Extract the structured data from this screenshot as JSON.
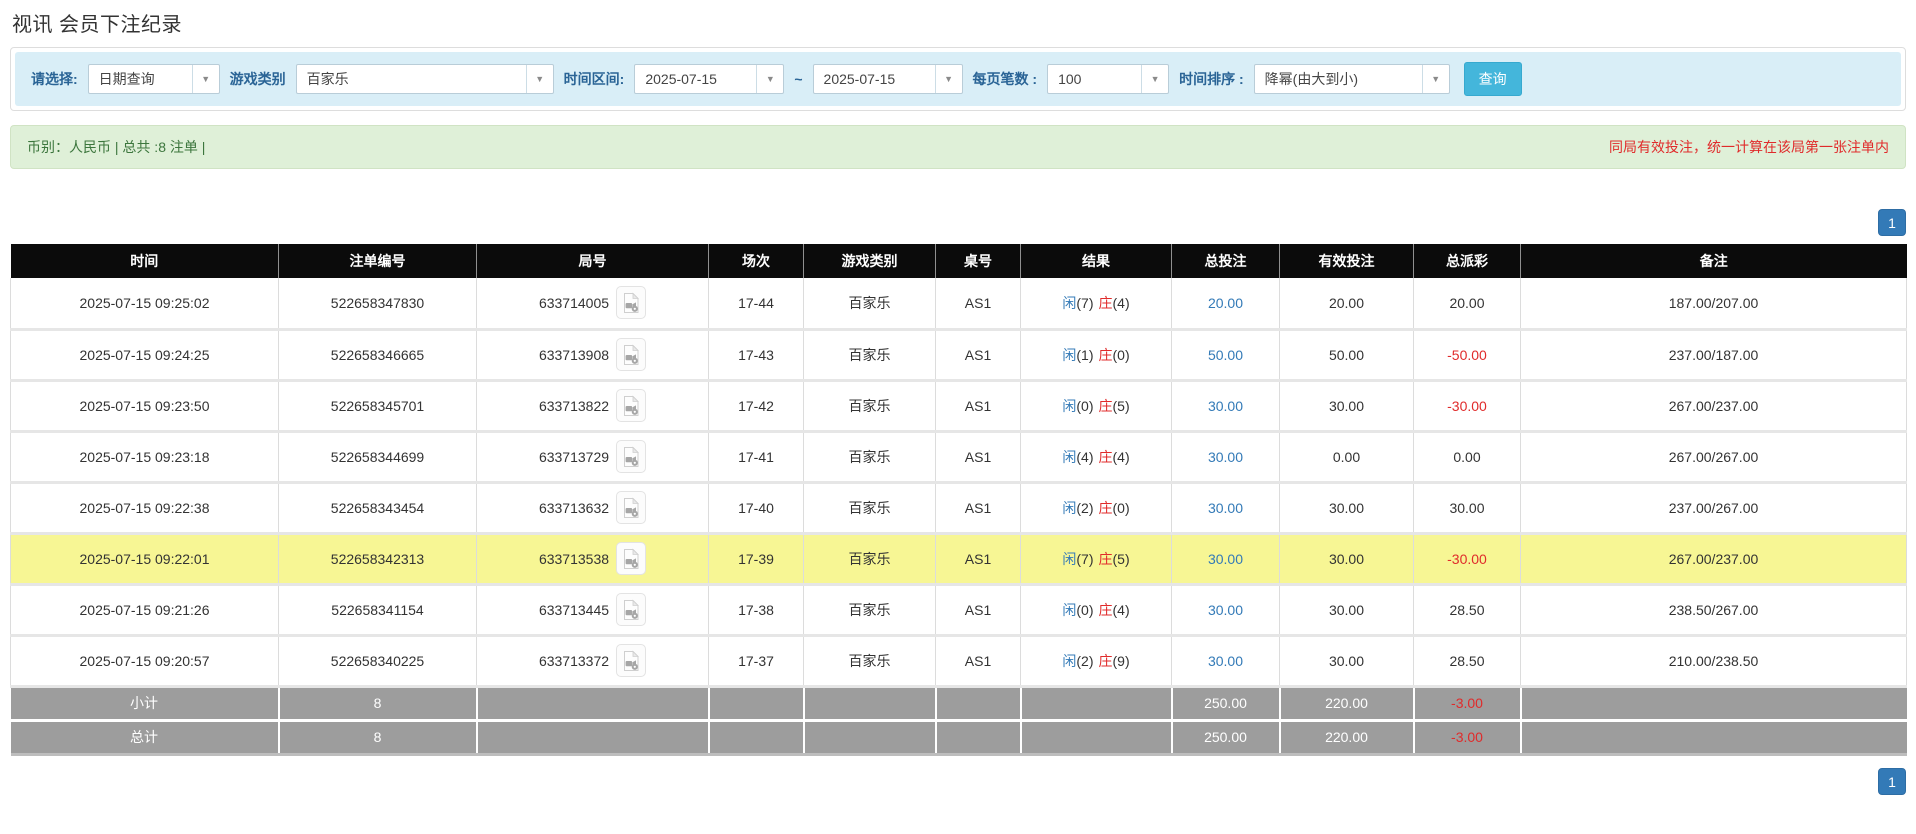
{
  "page_title": "视讯 会员下注纪录",
  "colors": {
    "filter_bg": "#d9eef7",
    "label_blue": "#2a6496",
    "button_cyan": "#44b6db",
    "summary_bg": "#dff0d8",
    "summary_green": "#3c763d",
    "alert_red": "#e02b2b",
    "header_bg": "#0b0b0b",
    "link_blue": "#337ab7",
    "player_blue": "#337ab7",
    "highlight_yellow": "#f7f694",
    "footer_gray": "#9d9d9d",
    "pagination_blue": "#337ab7"
  },
  "filters": {
    "query_type": {
      "label": "请选择:",
      "value": "日期查询"
    },
    "game_category": {
      "label": "游戏类别",
      "value": "百家乐"
    },
    "time_range": {
      "label": "时间区间:",
      "from": "2025-07-15",
      "separator": "~",
      "to": "2025-07-15"
    },
    "page_size": {
      "label": "每页笔数 :",
      "value": "100"
    },
    "time_order": {
      "label": "时间排序 :",
      "value": "降幂(由大到小)"
    },
    "search_button": "查询"
  },
  "summary": {
    "left": "币别：人民币 | 总共 :8 注单 |",
    "right_notice": "同局有效投注，统一计算在该局第一张注单内"
  },
  "pagination": {
    "page": "1"
  },
  "table": {
    "headers": [
      "时间",
      "注单编号",
      "局号",
      "场次",
      "游戏类别",
      "桌号",
      "结果",
      "总投注",
      "有效投注",
      "总派彩",
      "备注"
    ],
    "rows": [
      {
        "time": "2025-07-15 09:25:02",
        "bet_id": "522658347830",
        "round_id": "633714005",
        "session": "17-44",
        "game": "百家乐",
        "table_no": "AS1",
        "result_player": "闲",
        "result_player_n": "(7)",
        "result_banker": "庄",
        "result_banker_n": "(4)",
        "total_bet": "20.00",
        "valid_bet": "20.00",
        "payout": "20.00",
        "remark": "187.00/207.00",
        "highlighted": false
      },
      {
        "time": "2025-07-15 09:24:25",
        "bet_id": "522658346665",
        "round_id": "633713908",
        "session": "17-43",
        "game": "百家乐",
        "table_no": "AS1",
        "result_player": "闲",
        "result_player_n": "(1)",
        "result_banker": "庄",
        "result_banker_n": "(0)",
        "total_bet": "50.00",
        "valid_bet": "50.00",
        "payout": "-50.00",
        "remark": "237.00/187.00",
        "highlighted": false
      },
      {
        "time": "2025-07-15 09:23:50",
        "bet_id": "522658345701",
        "round_id": "633713822",
        "session": "17-42",
        "game": "百家乐",
        "table_no": "AS1",
        "result_player": "闲",
        "result_player_n": "(0)",
        "result_banker": "庄",
        "result_banker_n": "(5)",
        "total_bet": "30.00",
        "valid_bet": "30.00",
        "payout": "-30.00",
        "remark": "267.00/237.00",
        "highlighted": false
      },
      {
        "time": "2025-07-15 09:23:18",
        "bet_id": "522658344699",
        "round_id": "633713729",
        "session": "17-41",
        "game": "百家乐",
        "table_no": "AS1",
        "result_player": "闲",
        "result_player_n": "(4)",
        "result_banker": "庄",
        "result_banker_n": "(4)",
        "total_bet": "30.00",
        "valid_bet": "0.00",
        "payout": "0.00",
        "remark": "267.00/267.00",
        "highlighted": false
      },
      {
        "time": "2025-07-15 09:22:38",
        "bet_id": "522658343454",
        "round_id": "633713632",
        "session": "17-40",
        "game": "百家乐",
        "table_no": "AS1",
        "result_player": "闲",
        "result_player_n": "(2)",
        "result_banker": "庄",
        "result_banker_n": "(0)",
        "total_bet": "30.00",
        "valid_bet": "30.00",
        "payout": "30.00",
        "remark": "237.00/267.00",
        "highlighted": false
      },
      {
        "time": "2025-07-15 09:22:01",
        "bet_id": "522658342313",
        "round_id": "633713538",
        "session": "17-39",
        "game": "百家乐",
        "table_no": "AS1",
        "result_player": "闲",
        "result_player_n": "(7)",
        "result_banker": "庄",
        "result_banker_n": "(5)",
        "total_bet": "30.00",
        "valid_bet": "30.00",
        "payout": "-30.00",
        "remark": "267.00/237.00",
        "highlighted": true
      },
      {
        "time": "2025-07-15 09:21:26",
        "bet_id": "522658341154",
        "round_id": "633713445",
        "session": "17-38",
        "game": "百家乐",
        "table_no": "AS1",
        "result_player": "闲",
        "result_player_n": "(0)",
        "result_banker": "庄",
        "result_banker_n": "(4)",
        "total_bet": "30.00",
        "valid_bet": "30.00",
        "payout": "28.50",
        "remark": "238.50/267.00",
        "highlighted": false
      },
      {
        "time": "2025-07-15 09:20:57",
        "bet_id": "522658340225",
        "round_id": "633713372",
        "session": "17-37",
        "game": "百家乐",
        "table_no": "AS1",
        "result_player": "闲",
        "result_player_n": "(2)",
        "result_banker": "庄",
        "result_banker_n": "(9)",
        "total_bet": "30.00",
        "valid_bet": "30.00",
        "payout": "28.50",
        "remark": "210.00/238.50",
        "highlighted": false
      }
    ],
    "footer_rows": [
      {
        "label": "小计",
        "count": "8",
        "total_bet": "250.00",
        "valid_bet": "220.00",
        "payout": "-3.00"
      },
      {
        "label": "总计",
        "count": "8",
        "total_bet": "250.00",
        "valid_bet": "220.00",
        "payout": "-3.00"
      }
    ]
  }
}
